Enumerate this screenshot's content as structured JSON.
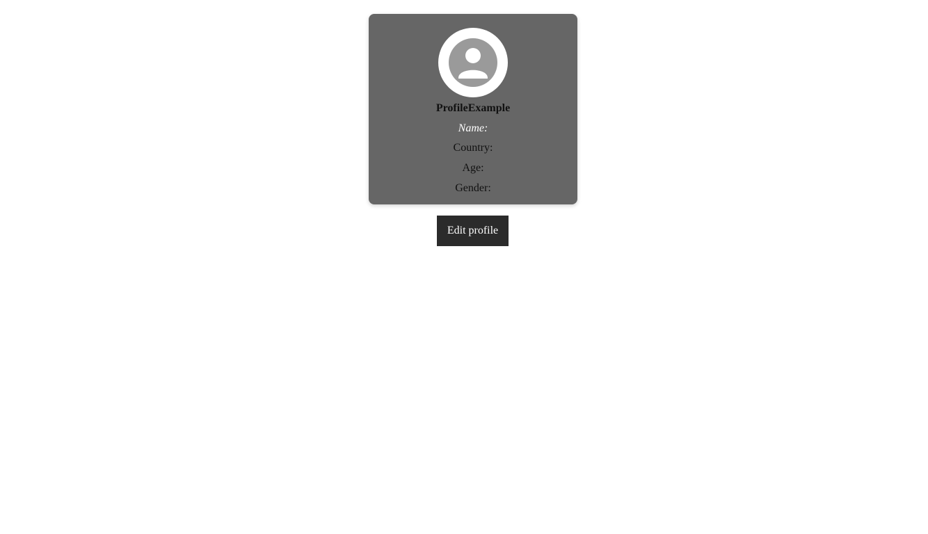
{
  "profile": {
    "username": "ProfileExample",
    "name_label": "Name:",
    "country_label": "Country:",
    "age_label": "Age:",
    "gender_label": "Gender:",
    "avatar_icon": "user-avatar-icon"
  },
  "actions": {
    "edit_label": "Edit profile"
  },
  "colors": {
    "card_background": "#666666",
    "avatar_ring": "#ffffff",
    "avatar_fill": "#9a9a9a",
    "button_background": "#2b2b2b"
  }
}
